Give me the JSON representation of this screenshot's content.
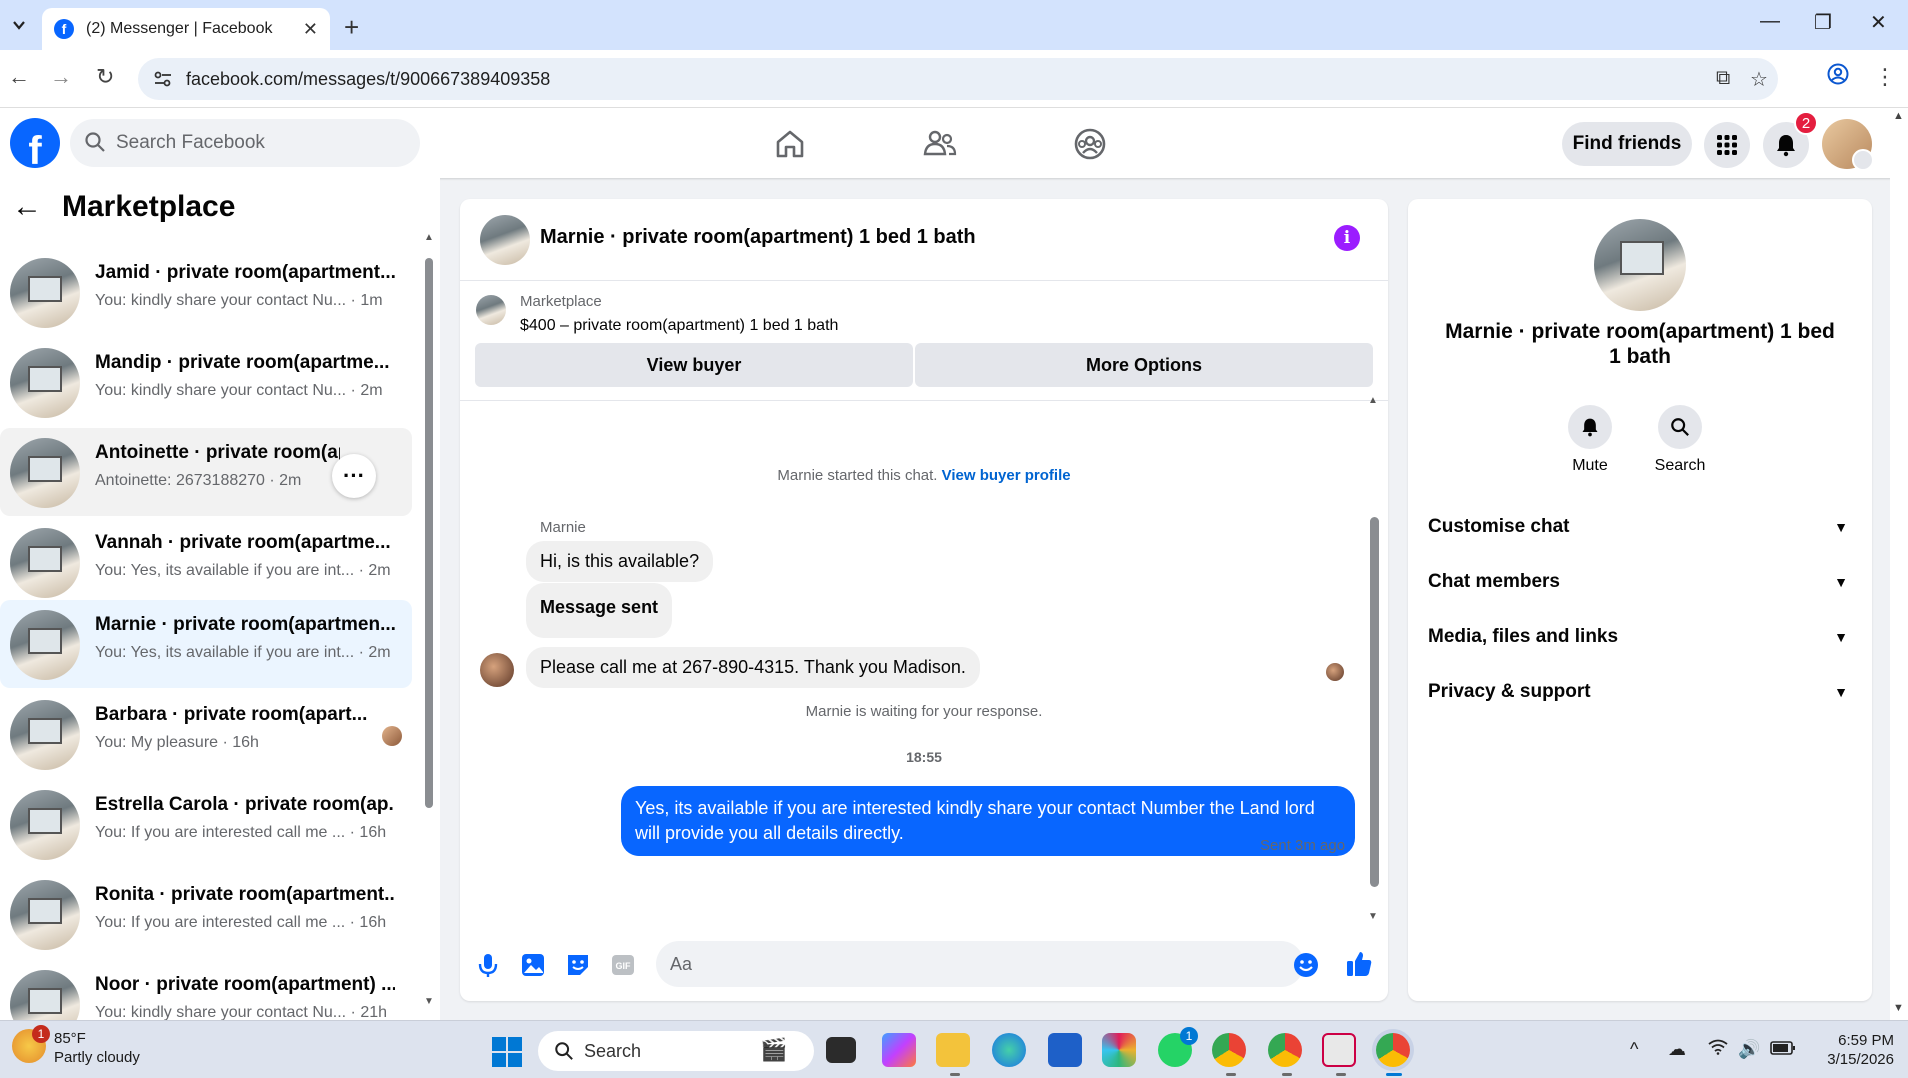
{
  "browser": {
    "tab_title": "(2) Messenger | Facebook",
    "url": "facebook.com/messages/t/900667389409358"
  },
  "fb": {
    "search_placeholder": "Search Facebook",
    "find_friends": "Find friends",
    "notifications_count": "2"
  },
  "sidebar": {
    "title": "Marketplace",
    "conversations": [
      {
        "title": "Jamid · private room(apartment...",
        "sub": "You: kindly share your contact Nu... · 1m"
      },
      {
        "title": "Mandip · private room(apartme...",
        "sub": "You: kindly share your contact Nu... · 2m"
      },
      {
        "title": "Antoinette · private room(ap...",
        "sub": "Antoinette: 2673188270 · 2m"
      },
      {
        "title": "Vannah · private room(apartme...",
        "sub": "You: Yes, its available if you are int... · 2m"
      },
      {
        "title": "Marnie · private room(apartmen...",
        "sub": "You: Yes, its available if you are int... · 2m"
      },
      {
        "title": "Barbara · private room(apart...",
        "sub": "You: My pleasure · 16h"
      },
      {
        "title": "Estrella Carola · private room(ap...",
        "sub": "You: If you are interested call me ... · 16h"
      },
      {
        "title": "Ronita · private room(apartment...",
        "sub": "You: If you are interested call me ... · 16h"
      },
      {
        "title": "Noor · private room(apartment) ...",
        "sub": "You: kindly share your contact Nu... · 21h"
      }
    ]
  },
  "chat": {
    "header_name": "Marnie · private room(apartment) 1 bed 1 bath",
    "listing_label": "Marketplace",
    "listing_price": "$400 – private room(apartment) 1 bed 1 bath",
    "view_buyer": "View buyer",
    "more_options": "More Options",
    "started_text": "Marnie started this chat.",
    "view_buyer_profile": "View buyer profile",
    "sender_name": "Marnie",
    "messages_in": [
      "Hi, is this available?",
      "Message sent",
      "Please call me at 267-890-4315.   Thank you Madison."
    ],
    "waiting_text": "Marnie is waiting for your response.",
    "timestamp": "18:55",
    "message_out": "Yes, its available if you are interested kindly share your contact Number the Land lord will provide you all details directly.",
    "sent_status": "Sent 3m ago",
    "composer_placeholder": "Aa"
  },
  "info": {
    "title": "Marnie · private room(apartment) 1 bed 1 bath",
    "mute": "Mute",
    "search": "Search",
    "sections": [
      "Customise chat",
      "Chat members",
      "Media, files and links",
      "Privacy & support"
    ]
  },
  "taskbar": {
    "temperature": "85°F",
    "weather": "Partly cloudy",
    "weather_badge": "1",
    "search": "Search",
    "whatsapp_badge": "1",
    "time": "6:59 PM",
    "date": "3/15/2026"
  },
  "colors": {
    "fb_blue": "#0866ff",
    "selected_row": "#ebf5ff",
    "info_purple": "#9b1dff"
  }
}
